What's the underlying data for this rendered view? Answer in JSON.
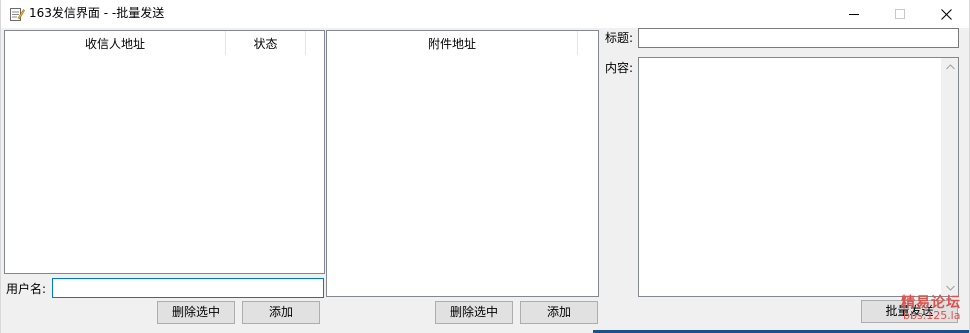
{
  "window": {
    "title": "163发信界面 - -批量发送",
    "app_icon": "notepad-pencil-icon"
  },
  "recipients": {
    "columns": [
      "收信人地址",
      "状态"
    ],
    "rows": []
  },
  "attachments": {
    "columns": [
      "附件地址"
    ],
    "rows": []
  },
  "form": {
    "username_label": "用户名:",
    "username_value": "",
    "subject_label": "标题:",
    "subject_value": "",
    "content_label": "内容:",
    "content_value": ""
  },
  "buttons": {
    "delete_selected_recipients": "删除选中",
    "add_recipient": "添加",
    "delete_selected_attachments": "删除选中",
    "add_attachment": "添加",
    "batch_send": "批量发送"
  },
  "watermark": {
    "line1": "精易论坛",
    "line2": "bbs.125.la"
  },
  "colors": {
    "accent": "#0078d7",
    "watermark": "#d9534f"
  }
}
